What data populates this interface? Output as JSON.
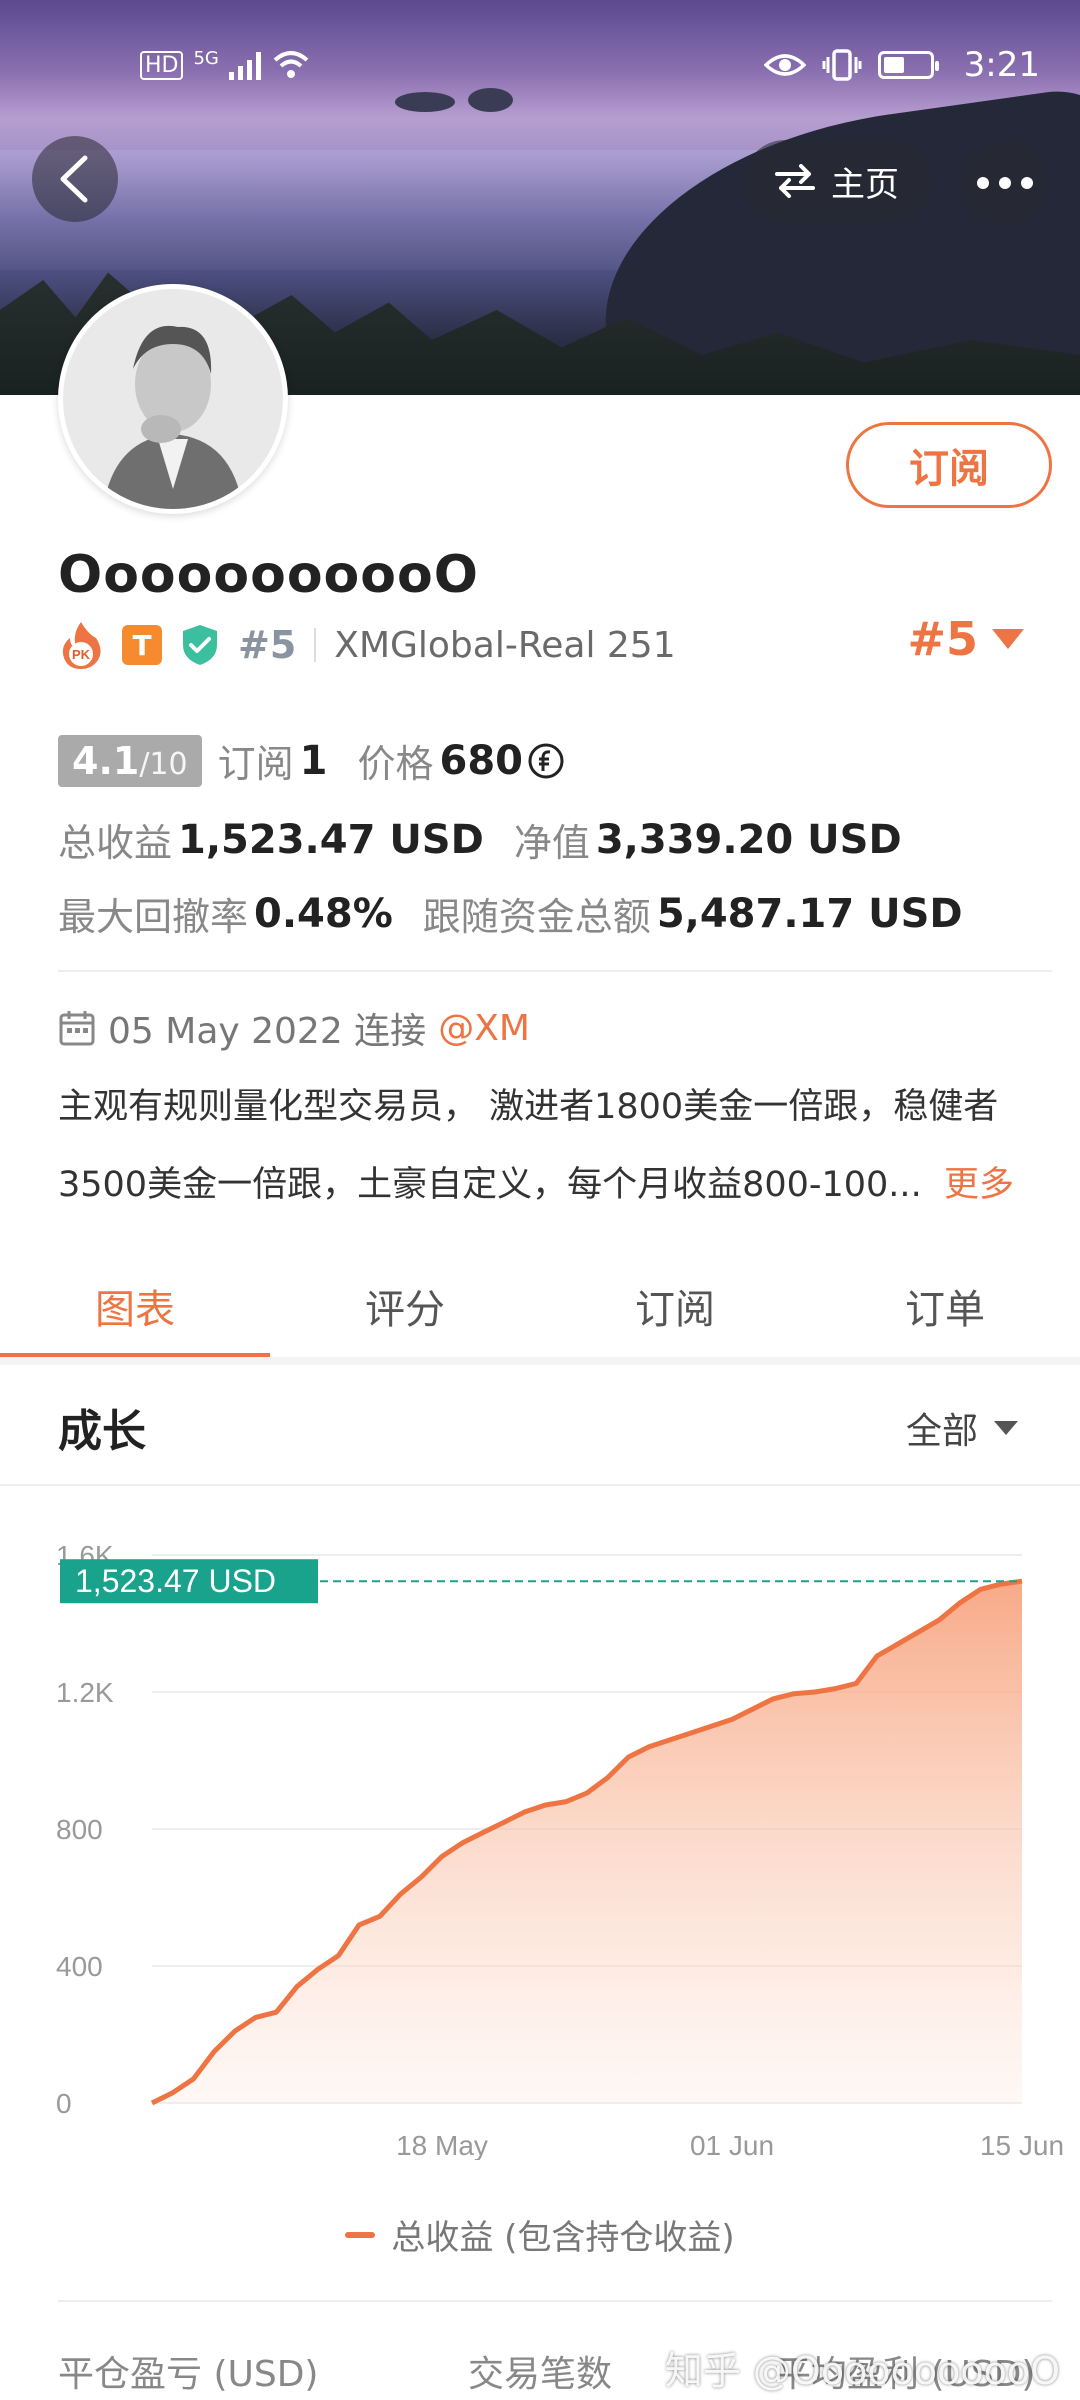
{
  "status_bar": {
    "hd": "HD",
    "net": "5G",
    "time": "3:21"
  },
  "header": {
    "home_label": "主页"
  },
  "profile": {
    "name": "OoooooooooO",
    "subscribe_label": "订阅",
    "rank_tag": "#5",
    "broker": "XMGlobal-Real 251",
    "rank_right": "#5",
    "pk_badge": "PK",
    "t_badge": "T"
  },
  "stats": {
    "score": "4.1",
    "score_max": "/10",
    "subscribe_label": "订阅",
    "subscribe_count": "1",
    "price_label": "价格",
    "price_value": "680",
    "total_profit_label": "总收益",
    "total_profit_value": "1,523.47 USD",
    "equity_label": "净值",
    "equity_value": "3,339.20 USD",
    "drawdown_label": "最大回撤率",
    "drawdown_value": "0.48%",
    "follow_label": "跟随资金总额",
    "follow_value": "5,487.17 USD"
  },
  "connection": {
    "date": "05 May 2022 连接",
    "source": "@XM"
  },
  "description": {
    "line1": "主观有规则量化型交易员， 激进者1800美金一倍跟，稳健者",
    "line2": "3500美金一倍跟，土豪自定义，每个月收益800-100...",
    "more": "更多"
  },
  "tabs": [
    "图表",
    "评分",
    "订阅",
    "订单"
  ],
  "growth": {
    "title": "成长",
    "filter": "全部"
  },
  "chart_data": {
    "type": "area",
    "y_ticks": [
      "0",
      "400",
      "800",
      "1.2K",
      "1.6K"
    ],
    "ylim": [
      0,
      1600
    ],
    "x_ticks": [
      "18 May",
      "01 Jun",
      "15 Jun"
    ],
    "x_tick_values": [
      14,
      28,
      42
    ],
    "xlim": [
      0,
      42
    ],
    "current_value": 1523.47,
    "current_label": "1,523.47 USD",
    "series": [
      {
        "name": "总收益 (包含持仓收益)",
        "x": [
          0,
          1,
          2,
          3,
          4,
          5,
          6,
          7,
          8,
          9,
          10,
          11,
          12,
          13,
          14,
          15,
          16,
          17,
          18,
          19,
          20,
          21,
          22,
          23,
          24,
          25,
          26,
          27,
          28,
          29,
          30,
          31,
          32,
          33,
          34,
          35,
          36,
          37,
          38,
          39,
          40,
          41,
          42
        ],
        "values": [
          0,
          30,
          70,
          150,
          210,
          250,
          265,
          340,
          390,
          430,
          520,
          545,
          610,
          660,
          720,
          760,
          790,
          820,
          850,
          870,
          880,
          905,
          950,
          1010,
          1040,
          1060,
          1080,
          1100,
          1120,
          1150,
          1180,
          1195,
          1200,
          1210,
          1225,
          1305,
          1340,
          1375,
          1410,
          1460,
          1500,
          1515,
          1523.47
        ]
      }
    ]
  },
  "legend": {
    "label": "总收益 (包含持仓收益)"
  },
  "bottom_stats": {
    "col1": "平仓盈亏 (USD)",
    "col2": "交易笔数",
    "col3": "平均盈利 (USD)"
  },
  "watermark": "知乎 @OoooooooooO",
  "colors": {
    "accent": "#ee7443",
    "teal": "#1aa38c",
    "gray": "#aaaaaa"
  }
}
